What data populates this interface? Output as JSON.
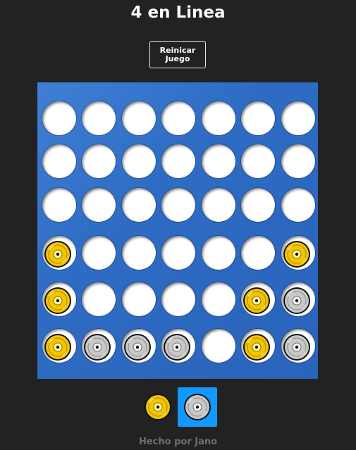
{
  "header": {
    "title": "4 en Linea"
  },
  "controls": {
    "reset_label": "Reinicar Juego"
  },
  "board": {
    "columns": 7,
    "rows": 6,
    "grid": [
      [
        "empty",
        "empty",
        "empty",
        "empty",
        "empty",
        "empty",
        "empty"
      ],
      [
        "empty",
        "empty",
        "empty",
        "empty",
        "empty",
        "empty",
        "empty"
      ],
      [
        "empty",
        "empty",
        "empty",
        "empty",
        "empty",
        "empty",
        "empty"
      ],
      [
        "yellow",
        "empty",
        "empty",
        "empty",
        "empty",
        "empty",
        "yellow"
      ],
      [
        "yellow",
        "empty",
        "empty",
        "empty",
        "empty",
        "yellow",
        "silver"
      ],
      [
        "yellow",
        "silver",
        "silver",
        "silver",
        "empty",
        "yellow",
        "silver"
      ]
    ]
  },
  "turn": {
    "players": [
      "yellow",
      "silver"
    ],
    "current": "silver"
  },
  "colors": {
    "background": "#222222",
    "board": "#2e6cc4",
    "yellow_disc": "#f2c500",
    "silver_disc": "#c8c8c8",
    "active_turn": "#1199ff",
    "footer_text": "#6f6f6f"
  },
  "footer": {
    "credit": "Hecho por Jano"
  }
}
